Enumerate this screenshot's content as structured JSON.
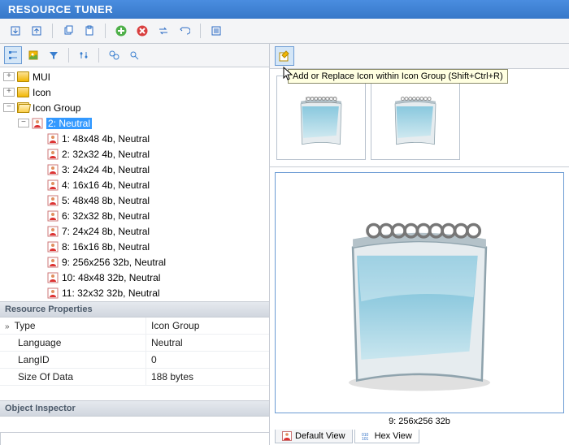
{
  "title": "RESOURCE TUNER",
  "toolbar": {
    "down": "↓",
    "up": "↑",
    "copy": "copy",
    "paste": "paste",
    "add": "+",
    "remove": "×",
    "swap": "swap",
    "undo": "undo",
    "props": "props"
  },
  "left_toolbar": {
    "tree": "tree",
    "image": "image",
    "filter": "filter",
    "sliders": "sliders",
    "find": "find",
    "find2": "find2"
  },
  "tree": {
    "root": [
      {
        "label": "MUI",
        "expanded": false,
        "icon": "folder"
      },
      {
        "label": "Icon",
        "expanded": false,
        "icon": "folder"
      },
      {
        "label": "Icon Group",
        "expanded": true,
        "icon": "folder-open",
        "children": [
          {
            "label": "2: Neutral",
            "expanded": true,
            "selected": true,
            "icon": "person",
            "children": [
              {
                "label": "1: 48x48 4b, Neutral",
                "icon": "person"
              },
              {
                "label": "2: 32x32 4b, Neutral",
                "icon": "person"
              },
              {
                "label": "3: 24x24 4b, Neutral",
                "icon": "person"
              },
              {
                "label": "4: 16x16 4b, Neutral",
                "icon": "person"
              },
              {
                "label": "5: 48x48 8b, Neutral",
                "icon": "person"
              },
              {
                "label": "6: 32x32 8b, Neutral",
                "icon": "person"
              },
              {
                "label": "7: 24x24 8b, Neutral",
                "icon": "person"
              },
              {
                "label": "8: 16x16 8b, Neutral",
                "icon": "person"
              },
              {
                "label": "9: 256x256 32b, Neutral",
                "icon": "person"
              },
              {
                "label": "10: 48x48 32b, Neutral",
                "icon": "person"
              },
              {
                "label": "11: 32x32 32b, Neutral",
                "icon": "person"
              }
            ]
          }
        ]
      }
    ]
  },
  "properties": {
    "header": "Resource Properties",
    "rows": [
      {
        "key": "Type",
        "val": "Icon Group"
      },
      {
        "key": "Language",
        "val": "Neutral"
      },
      {
        "key": "LangID",
        "val": "0"
      },
      {
        "key": "Size Of Data",
        "val": "188 bytes"
      }
    ]
  },
  "object_inspector": {
    "header": "Object Inspector"
  },
  "right": {
    "tooltip": "Add or Replace Icon within Icon Group (Shift+Ctrl+R)",
    "caption": "9: 256x256 32b"
  },
  "view_tabs": {
    "default": "Default View",
    "hex": "Hex View"
  }
}
